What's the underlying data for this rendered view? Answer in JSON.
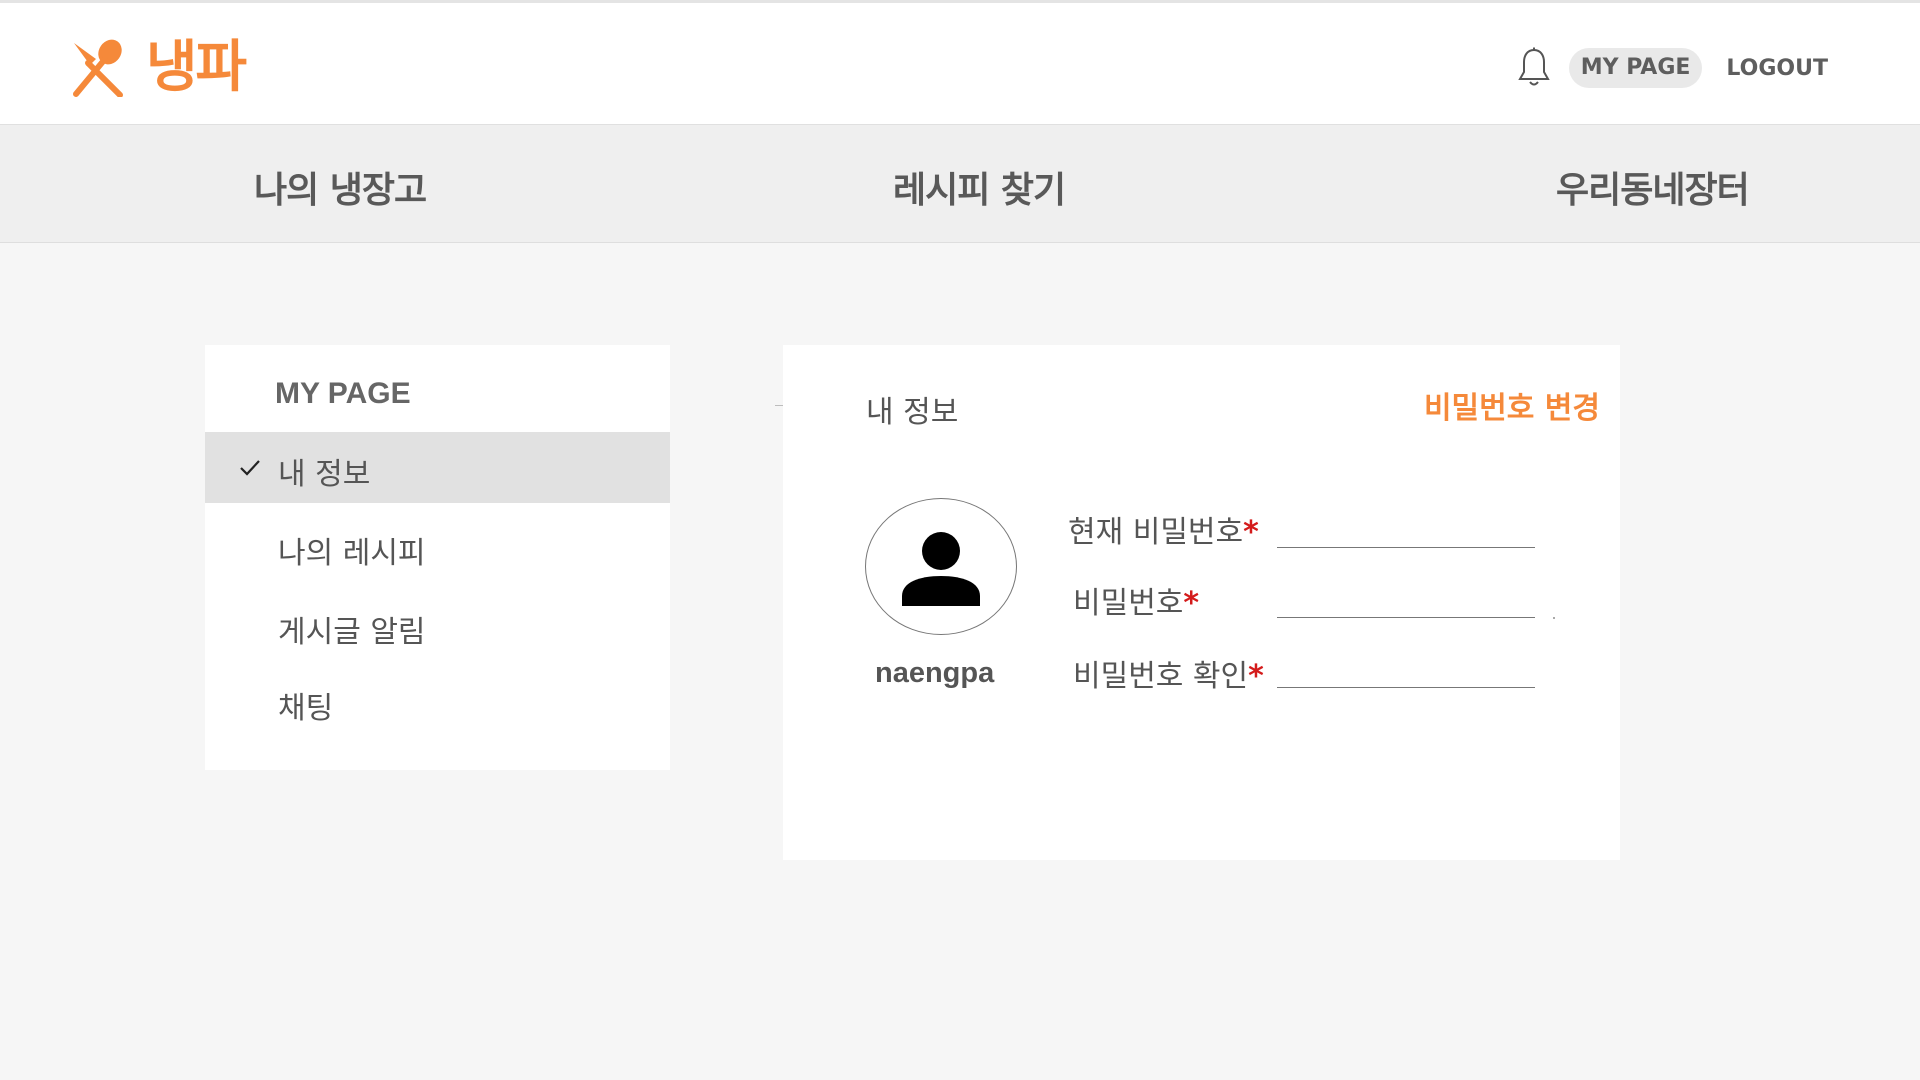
{
  "header": {
    "logo_text": "냉파",
    "logo_icon": "fork-spoon-icon",
    "bell_icon": "bell-icon",
    "mypage_label": "MY PAGE",
    "logout_label": "LOGOUT"
  },
  "nav": {
    "items": [
      {
        "label": "나의 냉장고"
      },
      {
        "label": "레시피 찾기"
      },
      {
        "label": "우리동네장터"
      }
    ]
  },
  "sidebar": {
    "title": "MY PAGE",
    "items": [
      {
        "label": "내 정보",
        "active": true
      },
      {
        "label": "나의 레시피",
        "active": false
      },
      {
        "label": "게시글 알림",
        "active": false
      },
      {
        "label": "채팅",
        "active": false
      }
    ]
  },
  "profile": {
    "title": "내 정보",
    "change_password_label": "비밀번호 변경",
    "avatar_icon": "user-icon",
    "username": "naengpa",
    "fields": [
      {
        "label": "현재 비밀번호",
        "required_mark": "*",
        "value": ""
      },
      {
        "label": "비밀번호",
        "required_mark": "*",
        "value": ""
      },
      {
        "label": "비밀번호 확인",
        "required_mark": "*",
        "value": ""
      }
    ]
  },
  "colors": {
    "accent": "#f5893a",
    "required": "#d41b1b",
    "nav_bg": "#efefef",
    "page_bg": "#f6f6f6",
    "active_item_bg": "#e1e1e1"
  }
}
